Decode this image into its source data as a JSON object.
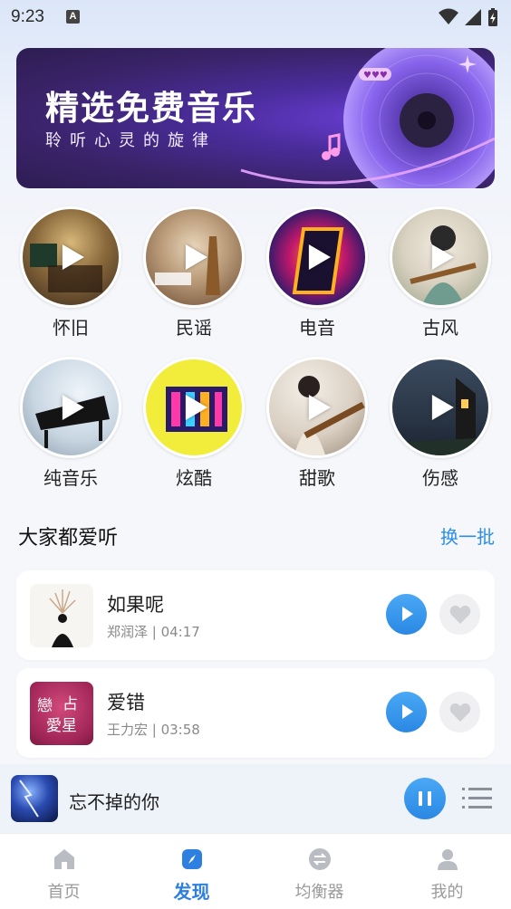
{
  "status_bar": {
    "time": "9:23",
    "indicator": "A"
  },
  "banner": {
    "title": "精选免费音乐",
    "subtitle": "聆听心灵的旋律"
  },
  "genres": [
    {
      "label": "怀旧"
    },
    {
      "label": "民谣"
    },
    {
      "label": "电音"
    },
    {
      "label": "古风"
    },
    {
      "label": "纯音乐"
    },
    {
      "label": "炫酷"
    },
    {
      "label": "甜歌"
    },
    {
      "label": "伤感"
    }
  ],
  "section": {
    "title": "大家都爱听",
    "action": "换一批"
  },
  "songs": [
    {
      "name": "如果呢",
      "meta": "郑润泽 | 04:17"
    },
    {
      "name": "爱错",
      "meta": "王力宏 | 03:58"
    }
  ],
  "now_playing": {
    "title": "忘不掉的你"
  },
  "nav": [
    {
      "label": "首页",
      "icon": "home-icon"
    },
    {
      "label": "发现",
      "icon": "compass-icon"
    },
    {
      "label": "均衡器",
      "icon": "equalizer-icon"
    },
    {
      "label": "我的",
      "icon": "user-icon"
    }
  ],
  "colors": {
    "accent": "#2d8ee6",
    "banner": "#4a2c9a",
    "background": "#f6f7fa"
  }
}
